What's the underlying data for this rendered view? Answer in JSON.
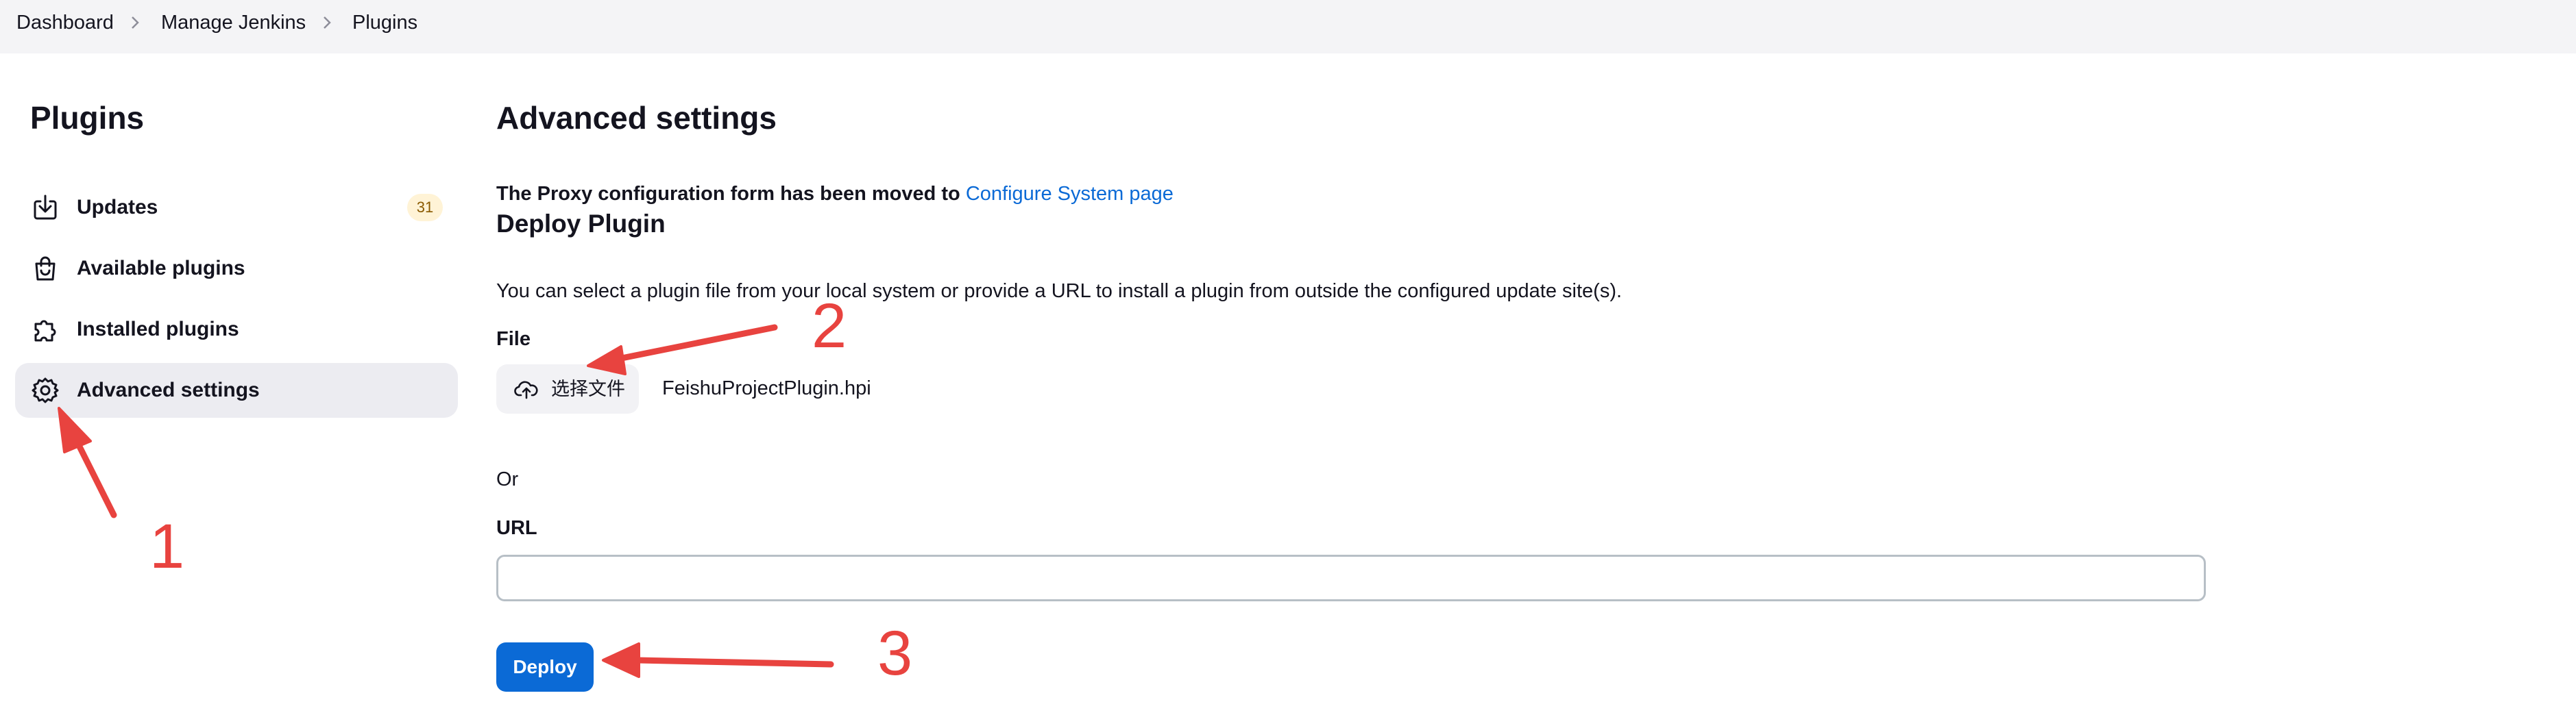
{
  "breadcrumb": {
    "items": [
      {
        "label": "Dashboard"
      },
      {
        "label": "Manage Jenkins"
      },
      {
        "label": "Plugins"
      }
    ]
  },
  "sidebar": {
    "title": "Plugins",
    "items": [
      {
        "label": "Updates",
        "icon": "download-icon",
        "badge": "31"
      },
      {
        "label": "Available plugins",
        "icon": "shopping-bag-icon"
      },
      {
        "label": "Installed plugins",
        "icon": "puzzle-icon"
      },
      {
        "label": "Advanced settings",
        "icon": "gear-icon",
        "active": true
      }
    ]
  },
  "main": {
    "title": "Advanced settings",
    "notice_text": "The Proxy configuration form has been moved to ",
    "notice_link": "Configure System page",
    "section_title": "Deploy Plugin",
    "description": "You can select a plugin file from your local system or provide a URL to install a plugin from outside the configured update site(s).",
    "file_label": "File",
    "choose_file_label": "选择文件",
    "file_name": "FeishuProjectPlugin.hpi",
    "or_label": "Or",
    "url_label": "URL",
    "url_value": "",
    "deploy_label": "Deploy"
  },
  "annotations": {
    "labels": [
      "1",
      "2",
      "3"
    ],
    "color": "#e8433f"
  },
  "colors": {
    "accent": "#0b6ad6",
    "badge_bg": "#fff3d6",
    "active_item_bg": "#ececf1",
    "topbar_bg": "#f4f4f6"
  }
}
